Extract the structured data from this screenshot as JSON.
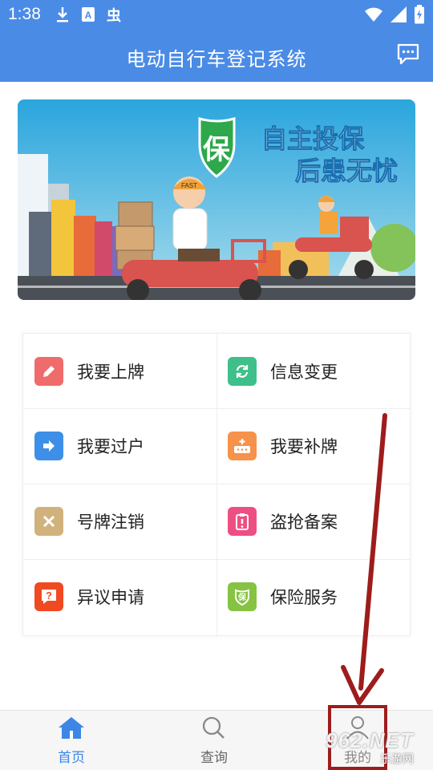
{
  "status": {
    "time": "1:38",
    "left_icons": [
      "download-icon",
      "font-icon",
      "bug-icon"
    ],
    "right_icons": [
      "wifi-icon",
      "signal-icon",
      "battery-icon"
    ]
  },
  "appbar": {
    "title": "电动自行车登记系统",
    "message_icon": "message-icon"
  },
  "banner": {
    "badge_char": "保",
    "line1": "自主投保",
    "line2": "后患无忧",
    "helmet_text": "FAST"
  },
  "menu": {
    "items": [
      {
        "label": "我要上牌",
        "icon": "pencil-icon",
        "color": "#f06b6b"
      },
      {
        "label": "信息变更",
        "icon": "refresh-icon",
        "color": "#3fbf8a"
      },
      {
        "label": "我要过户",
        "icon": "arrow-right-icon",
        "color": "#3d8fe8"
      },
      {
        "label": "我要补牌",
        "icon": "plate-add-icon",
        "color": "#f7924a"
      },
      {
        "label": "号牌注销",
        "icon": "close-icon",
        "color": "#d2b27c"
      },
      {
        "label": "盗抢备案",
        "icon": "alert-clipboard-icon",
        "color": "#ee4f83"
      },
      {
        "label": "异议申请",
        "icon": "question-icon",
        "color": "#f04a22"
      },
      {
        "label": "保险服务",
        "icon": "shield-icon",
        "color": "#86c342"
      }
    ]
  },
  "nav": {
    "home": {
      "label": "首页",
      "icon": "home-icon",
      "active_color": "#3d86e6"
    },
    "query": {
      "label": "查询",
      "icon": "search-icon"
    },
    "me": {
      "label": "我的",
      "icon": "user-icon"
    }
  },
  "watermark": {
    "number": "962.NET",
    "site": "乐游网"
  }
}
